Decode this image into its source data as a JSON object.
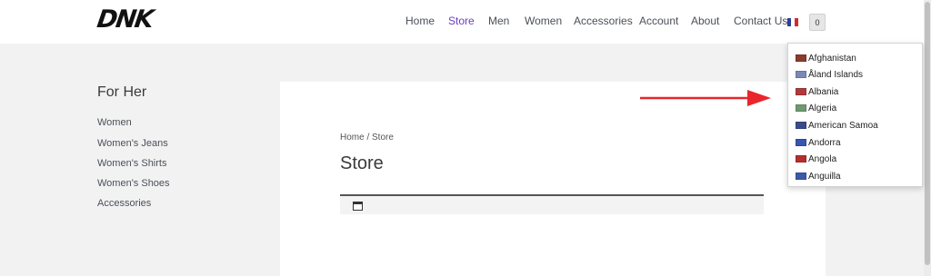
{
  "brand": {
    "logo_text": "DNK"
  },
  "nav": {
    "items": [
      {
        "label": "Home"
      },
      {
        "label": "Store",
        "active": true
      },
      {
        "label": "Men"
      },
      {
        "label": "Women"
      },
      {
        "label": "Accessories"
      },
      {
        "label": "Account"
      },
      {
        "label": "About"
      },
      {
        "label": "Contact Us"
      }
    ],
    "active_color": "#6a3ebd",
    "language_flag_icon": "flag-icon"
  },
  "cart": {
    "count": "0"
  },
  "sidebar": {
    "title": "For Her",
    "links": [
      {
        "label": "Women"
      },
      {
        "label": "Women's Jeans"
      },
      {
        "label": "Women's Shirts"
      },
      {
        "label": "Women's Shoes"
      },
      {
        "label": "Accessories"
      }
    ]
  },
  "main": {
    "breadcrumb": "Home / Store",
    "title": "Store",
    "toolbar_icon": "calendar-icon"
  },
  "annotation": {
    "arrow_color": "#e8262b"
  },
  "country_dropdown": {
    "items": [
      {
        "name": "Afghanistan",
        "flag_color": "#8a3b2e"
      },
      {
        "name": "Åland Islands",
        "flag_color": "#7a88b8"
      },
      {
        "name": "Albania",
        "flag_color": "#b03a3a"
      },
      {
        "name": "Algeria",
        "flag_color": "#6f9a6f"
      },
      {
        "name": "American Samoa",
        "flag_color": "#3b4a8a"
      },
      {
        "name": "Andorra",
        "flag_color": "#3655b0"
      },
      {
        "name": "Angola",
        "flag_color": "#b2302e"
      },
      {
        "name": "Anguilla",
        "flag_color": "#3b5aa8"
      }
    ]
  }
}
